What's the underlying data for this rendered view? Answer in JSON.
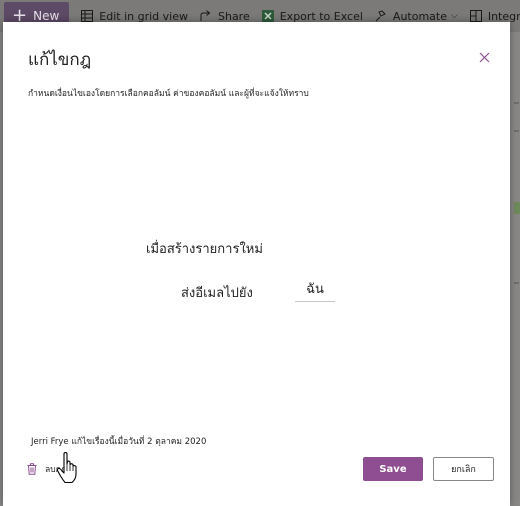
{
  "toolbar": {
    "new_label": "New",
    "edit_grid_label": "Edit in grid view",
    "share_label": "Share",
    "export_label": "Export to Excel",
    "automate_label": "Automate",
    "integrate_label": "Integrate"
  },
  "dialog": {
    "title": "แก้ไขกฎ",
    "description": "กำหนดเงื่อนไขเองโดยการเลือกคอลัมน์ ค่าของคอลัมน์ และผู้ที่จะแจ้งให้ทราบ",
    "condition_text": "เมื่อสร้างรายการใหม่",
    "action_text": "ส่งอีเมลไปยัง",
    "recipient": "ฉัน",
    "modified_text": "Jerri Frye แก้ไขเรื่องนี้เมื่อวันที่ 2 ตุลาคม 2020",
    "delete_label": "ลบกฎ",
    "save_label": "Save",
    "cancel_label": "ยกเลิก"
  },
  "colors": {
    "accent": "#8e4e91",
    "close_icon": "#8e4e91"
  },
  "icons": [
    "plus-icon",
    "grid-icon",
    "share-icon",
    "excel-icon",
    "automate-icon",
    "integrate-icon",
    "close-icon",
    "trash-icon",
    "hand-cursor-icon"
  ]
}
